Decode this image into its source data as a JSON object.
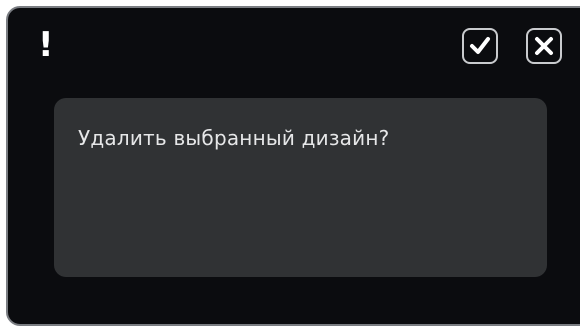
{
  "dialog": {
    "alert_symbol": "!",
    "message": "Удалить выбранный дизайн?",
    "confirm_icon": "checkmark-icon",
    "cancel_icon": "close-icon"
  },
  "colors": {
    "background": "#0b0c0f",
    "panel": "#303234",
    "text": "#e6e7e8",
    "button_border": "#c9cbce"
  }
}
